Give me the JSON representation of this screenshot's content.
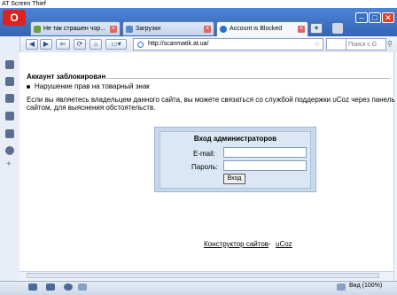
{
  "capture_title": "AT Screen Thief",
  "window": {
    "tabs": [
      {
        "label": "Не так страшен чор...",
        "active": false
      },
      {
        "label": "Загрузки",
        "active": false
      },
      {
        "label": "Account is Blocked",
        "active": true
      }
    ],
    "new_tab": "+",
    "controls": {
      "minimize": "–",
      "maximize": "□",
      "close": "✕"
    }
  },
  "nav": {
    "url": "http://scanmatik.at.ua/",
    "search_placeholder": "Поиск с G",
    "back_icon": "◀",
    "forward_icon": "▶",
    "reload_icon": "⟳",
    "home_icon": "⌂"
  },
  "page": {
    "blocked_title": "Аккаунт заблокирован",
    "reason": "Нарушение прав на товарный знак",
    "info_line1": "Если вы являетесь владельцем данного сайта, вы можете связаться со службой поддержки uCoz через панель",
    "info_line2": "сайтом, для выяснения обстоятельств.",
    "admin": {
      "title": "Вход администраторов",
      "email_label": "E-mail:",
      "password_label": "Пароль:",
      "login_button": "Вход"
    },
    "footer": {
      "link": "Конструктор сайтов",
      "separator": "-",
      "ucoz": "uCoz"
    }
  },
  "status": {
    "zoom": "Вид (100%)"
  },
  "colors": {
    "accent": "#3a6fc4",
    "login_panel": "#c8d8ea"
  }
}
